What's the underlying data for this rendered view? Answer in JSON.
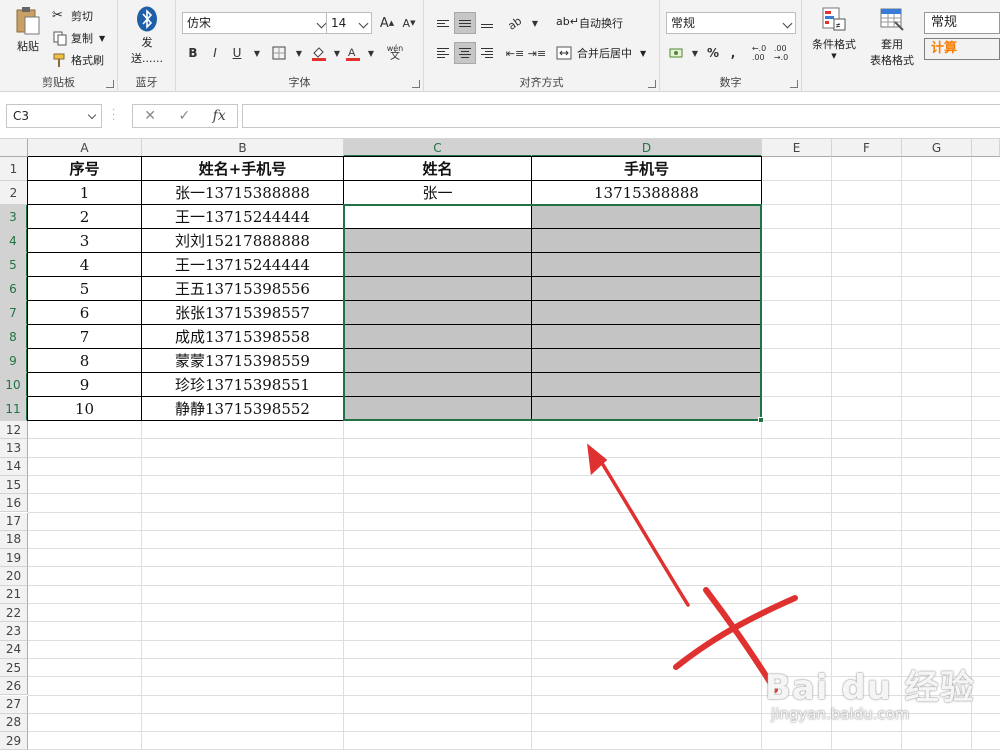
{
  "ribbon": {
    "clipboard": {
      "paste": "粘贴",
      "cut": "剪切",
      "copy": "复制",
      "format_painter": "格式刷",
      "label": "剪贴板"
    },
    "bluetooth": {
      "send": "发",
      "send2": "送......",
      "label": "蓝牙"
    },
    "font": {
      "name": "仿宋",
      "size": "14",
      "bold": "B",
      "italic": "I",
      "underline": "U",
      "grow": "A",
      "shrink": "A",
      "phonetic": "wén",
      "label": "字体"
    },
    "align": {
      "wrap": "自动换行",
      "merge": "合并后居中",
      "label": "对齐方式"
    },
    "number": {
      "format": "常规",
      "percent": "%",
      "comma": ",",
      "label": "数字"
    },
    "styles": {
      "cond_format": "条件格式",
      "table_format1": "套用",
      "table_format2": "表格格式",
      "normal": "常规",
      "calc": "计算"
    }
  },
  "formula_bar": {
    "name_box": "C3",
    "cancel": "✕",
    "enter": "✓",
    "fx": "fx",
    "formula": ""
  },
  "columns": [
    "A",
    "B",
    "C",
    "D",
    "E",
    "F",
    "G"
  ],
  "rows": [
    "1",
    "2",
    "3",
    "4",
    "5",
    "6",
    "7",
    "8",
    "9",
    "10",
    "11",
    "12",
    "13",
    "14",
    "15",
    "16",
    "17",
    "18",
    "19",
    "20",
    "21",
    "22",
    "23",
    "24",
    "25",
    "26",
    "27",
    "28",
    "29"
  ],
  "table": {
    "headers": [
      "序号",
      "姓名+手机号",
      "姓名",
      "手机号"
    ],
    "rows": [
      [
        "1",
        "张一13715388888",
        "张一",
        "13715388888"
      ],
      [
        "2",
        "王一13715244444",
        "",
        ""
      ],
      [
        "3",
        "刘刘15217888888",
        "",
        ""
      ],
      [
        "4",
        "王一13715244444",
        "",
        ""
      ],
      [
        "5",
        "王五13715398556",
        "",
        ""
      ],
      [
        "6",
        "张张13715398557",
        "",
        ""
      ],
      [
        "7",
        "成成13715398558",
        "",
        ""
      ],
      [
        "8",
        "蒙蒙13715398559",
        "",
        ""
      ],
      [
        "9",
        "珍珍13715398551",
        "",
        ""
      ],
      [
        "10",
        "静静13715398552",
        "",
        ""
      ]
    ]
  },
  "watermark": {
    "brand": "Bai du 经验",
    "url": "jingyan.baidu.com"
  },
  "colors": {
    "accent": "#217346",
    "annotation": "#e03131",
    "selection_fill": "#c4c4c4"
  }
}
